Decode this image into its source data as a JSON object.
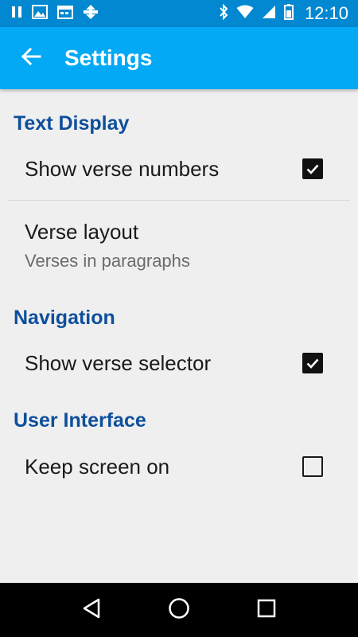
{
  "status_bar": {
    "time": "12:10",
    "left_icons": [
      "pause-icon",
      "image-icon",
      "calendar-icon",
      "sync-icon"
    ],
    "right_icons": [
      "bluetooth-icon",
      "wifi-icon",
      "signal-icon",
      "battery-icon"
    ]
  },
  "app_bar": {
    "title": "Settings",
    "back_icon": "arrow-back-icon",
    "background": "#03a9f4",
    "status_background": "#0288d1"
  },
  "sections": {
    "text_display": {
      "header": "Text Display",
      "show_verse_numbers": {
        "title": "Show verse numbers",
        "checked": true
      },
      "verse_layout": {
        "title": "Verse layout",
        "summary": "Verses in paragraphs"
      }
    },
    "navigation": {
      "header": "Navigation",
      "show_verse_selector": {
        "title": "Show verse selector",
        "checked": true
      }
    },
    "user_interface": {
      "header": "User Interface",
      "keep_screen_on": {
        "title": "Keep screen on",
        "checked": false
      }
    }
  },
  "colors": {
    "section_header": "#0d4f9c",
    "background": "#efefef"
  },
  "nav_bar": {
    "icons": [
      "back-triangle-icon",
      "home-circle-icon",
      "recents-square-icon"
    ]
  }
}
